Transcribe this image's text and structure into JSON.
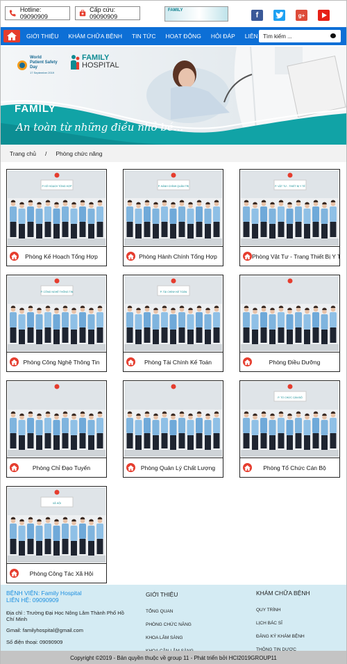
{
  "topbar": {
    "hotline": "Hotline: 09090909",
    "emergency": "Cấp cứu: 09090909",
    "mini_banner": "FAMILY"
  },
  "nav": {
    "items": [
      "GIỚI THIỆU",
      "KHÁM CHỮA BỆNH",
      "TIN TỨC",
      "HOẠT ĐỘNG",
      "HỎI ĐÁP",
      "LIÊN HỆ"
    ],
    "search_placeholder": "Tìm kiếm ..."
  },
  "hero": {
    "logo1": [
      "World",
      "Patient Safety",
      "Day",
      "17 September 2019"
    ],
    "logo2_brand": "FAMILY",
    "logo2_sub": "HOSPITAL",
    "brand": "FAMILY",
    "slogan": "An toàn từ những điều nhỏ bé..."
  },
  "breadcrumb": {
    "home": "Trang chủ",
    "sep": "/",
    "current": "Phòng chức năng"
  },
  "departments": [
    {
      "label": "Phòng Kế Hoạch Tổng Hợp",
      "sign": "P. KẾ HOẠCH TỔNG HỢP"
    },
    {
      "label": "Phòng Hành Chính Tổng Hợp",
      "sign": "P. HÀNH CHÍNH QUẢN TRỊ"
    },
    {
      "label": "Phòng Vật Tư - Trang Thiết Bị Y Tế",
      "sign": "P. VẬT TƯ - THIẾT BỊ Y TẾ"
    },
    {
      "label": "Phòng Công Nghệ Thông Tin",
      "sign": "P. CÔNG NGHỆ THÔNG TIN"
    },
    {
      "label": "Phòng Tài Chính Kế Toán",
      "sign": "P. TÀI CHÍNH KẾ TOÁN"
    },
    {
      "label": "Phòng Điều Dưỡng",
      "sign": ""
    },
    {
      "label": "Phòng Chỉ Đạo Tuyến",
      "sign": ""
    },
    {
      "label": "Phòng Quản Lý Chất Lượng",
      "sign": ""
    },
    {
      "label": "Phòng Tổ Chức Cán Bộ",
      "sign": "P. TỔ CHỨC CÁN BỘ"
    },
    {
      "label": "Phòng Công Tác Xã Hội",
      "sign": "XÃ HỘI"
    }
  ],
  "footer": {
    "col1": {
      "title1": "BỆNH VIỆN: Family Hospital",
      "title2": "LIÊN HỆ: 09090909",
      "address": "Địa chỉ : Trường Đại Học Nông Lâm Thành Phố Hồ Chí Minh",
      "gmail": "Gmail: familyhospital@gmail.com",
      "phone": "Số điện thoại: 09090909"
    },
    "col2": {
      "title": "GIỚI THIỆU",
      "items": [
        "TỔNG QUAN",
        "PHÒNG CHỨC NĂNG",
        "KHOA LÂM SÀNG",
        "KHOA CẬN LÂM SÀNG"
      ]
    },
    "col3": {
      "title": "KHÁM CHỮA BỆNH",
      "items": [
        "QUY TRÌNH",
        "LỊCH BÁC SĨ",
        "ĐĂNG KÝ KHÁM BỆNH",
        "THÔNG TIN DƯỢC"
      ]
    },
    "copyright": "Copyright ©2019 - Bản quyền thuộc về group 11 - Phát triển bởi HCI2019GROUP11"
  },
  "colors": {
    "nav": "#0d6fd6",
    "home_red": "#e53d2e",
    "teal": "#11a3a6",
    "footer_bg": "#d4ebf3"
  }
}
